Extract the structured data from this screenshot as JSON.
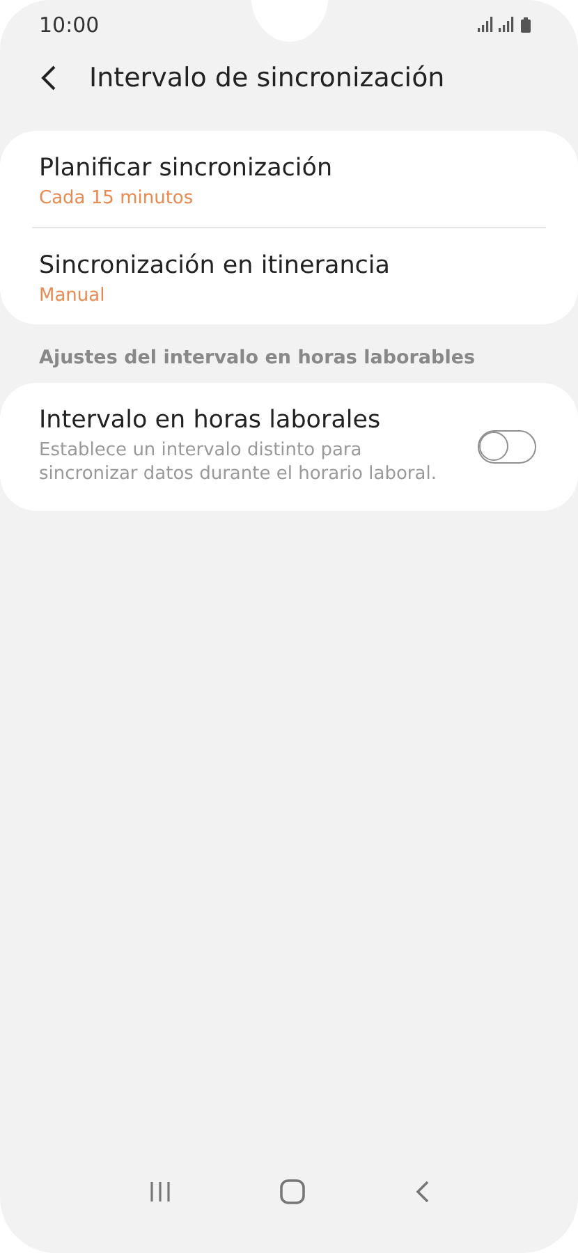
{
  "status_bar": {
    "time": "10:00"
  },
  "header": {
    "title": "Intervalo de sincronización"
  },
  "groups": [
    {
      "items": [
        {
          "kind": "value",
          "title": "Planificar sincronización",
          "value": "Cada 15 minutos"
        },
        {
          "kind": "value",
          "title": "Sincronización en itinerancia",
          "value": "Manual"
        }
      ]
    },
    {
      "heading": "Ajustes del intervalo en horas laborables",
      "items": [
        {
          "kind": "switch",
          "title": "Intervalo en horas laborales",
          "description": "Establece un intervalo distinto para sincronizar datos durante el horario laboral.",
          "on": false
        }
      ]
    }
  ]
}
